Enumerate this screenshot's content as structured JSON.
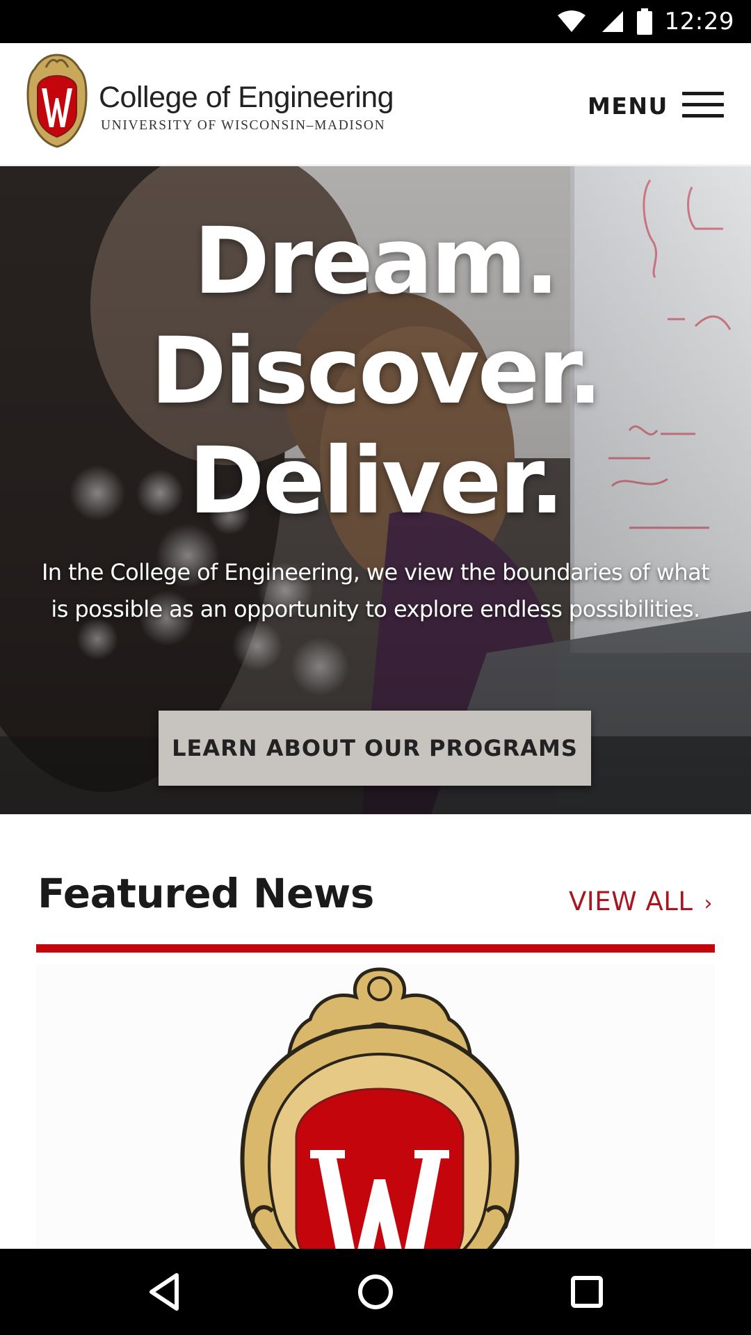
{
  "status_bar": {
    "time": "12:29",
    "icons": [
      "wifi-icon",
      "cellular-signal-icon",
      "battery-icon"
    ]
  },
  "header": {
    "brand_title": "College of Engineering",
    "brand_subtitle": "UNIVERSITY OF WISCONSIN–MADISON",
    "menu_label": "MENU",
    "crest_letter": "W"
  },
  "hero": {
    "headline": [
      "Dream.",
      "Discover.",
      "Deliver."
    ],
    "body": "In the College of Engineering, we view the boundaries of what is possible as an opportunity to explore endless possibilities.",
    "cta_label": "LEARN ABOUT OUR PROGRAMS"
  },
  "featured_news": {
    "title": "Featured News",
    "view_all_label": "VIEW ALL",
    "view_all_chevron": "›",
    "card_crest_letter": "W"
  },
  "nav_bar": {
    "buttons": [
      "back-icon",
      "home-icon",
      "recents-icon"
    ]
  },
  "colors": {
    "accent_red": "#c5050c",
    "link_red": "#a6171f",
    "crest_gold": "#c9a85b",
    "cta_background": "#c7c4c0",
    "status_bar": "#000000"
  }
}
